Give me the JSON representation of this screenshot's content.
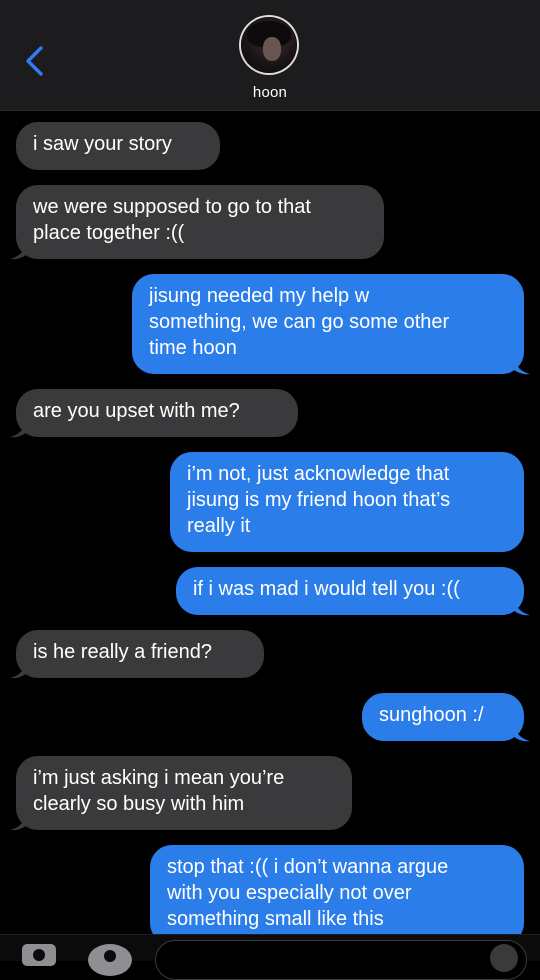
{
  "contact": {
    "name": "hoon"
  },
  "messages": [
    {
      "side": "in",
      "text": "i saw your story"
    },
    {
      "side": "in",
      "text": "we were supposed to go to that\nplace together :(("
    },
    {
      "side": "out",
      "text": "jisung needed my help w\nsomething, we can go some other\ntime hoon"
    },
    {
      "side": "in",
      "text": "are you upset with me?"
    },
    {
      "side": "out",
      "text": "i’m not, just acknowledge that\njisung is my friend hoon that’s\nreally it"
    },
    {
      "side": "out",
      "text": "if i was mad i would tell you :(("
    },
    {
      "side": "in",
      "text": "is he really a friend?"
    },
    {
      "side": "out",
      "text": "sunghoon :/"
    },
    {
      "side": "in",
      "text": "i’m just asking i mean you’re\nclearly so busy with him"
    },
    {
      "side": "out",
      "text": "stop that :(( i don’t wanna argue\nwith you especially not over\nsomething small like this"
    }
  ],
  "colors": {
    "incoming_bubble": "#3a3a3c",
    "outgoing_bubble": "#2b7de9",
    "accent": "#2f7cf6",
    "header_bg": "#1c1c1e"
  },
  "icons": {
    "back": "chevron-left-icon",
    "camera": "camera-icon",
    "apps": "app-store-icon",
    "mic": "audio-icon"
  }
}
